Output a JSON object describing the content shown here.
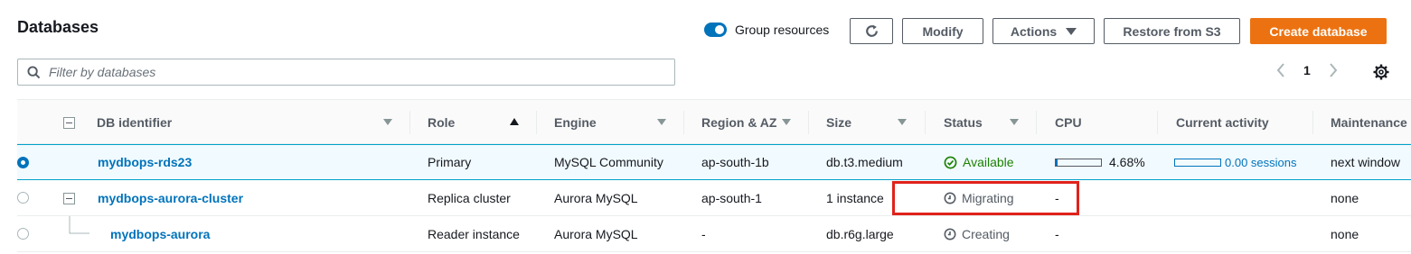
{
  "header": {
    "title": "Databases",
    "group_toggle_label": "Group resources",
    "refresh_icon": "refresh-icon",
    "modify_label": "Modify",
    "actions_label": "Actions",
    "restore_label": "Restore from S3",
    "create_label": "Create database"
  },
  "search": {
    "placeholder": "Filter by databases"
  },
  "pager": {
    "page": "1"
  },
  "columns": {
    "db_identifier": "DB identifier",
    "role": "Role",
    "engine": "Engine",
    "region": "Region & AZ",
    "size": "Size",
    "status": "Status",
    "cpu": "CPU",
    "activity": "Current activity",
    "maintenance": "Maintenance"
  },
  "rows": [
    {
      "id": "mydbops-rds23",
      "role": "Primary",
      "engine": "MySQL Community",
      "region": "ap-south-1b",
      "size": "db.t3.medium",
      "status": "Available",
      "cpu": "4.68%",
      "cpu_fraction": 0.0468,
      "activity": "0.00 sessions",
      "maintenance": "next window"
    },
    {
      "id": "mydbops-aurora-cluster",
      "role": "Replica cluster",
      "engine": "Aurora MySQL",
      "region": "ap-south-1",
      "size": "1 instance",
      "status": "Migrating",
      "cpu": "-",
      "activity": "",
      "maintenance": "none"
    },
    {
      "id": "mydbops-aurora",
      "role": "Reader instance",
      "engine": "Aurora MySQL",
      "region": "-",
      "size": "db.r6g.large",
      "status": "Creating",
      "cpu": "-",
      "activity": "",
      "maintenance": "none"
    }
  ],
  "colors": {
    "accent": "#0073bb",
    "primary_button": "#ec7211",
    "available": "#1d8102",
    "highlight_box": "#e0221b"
  }
}
